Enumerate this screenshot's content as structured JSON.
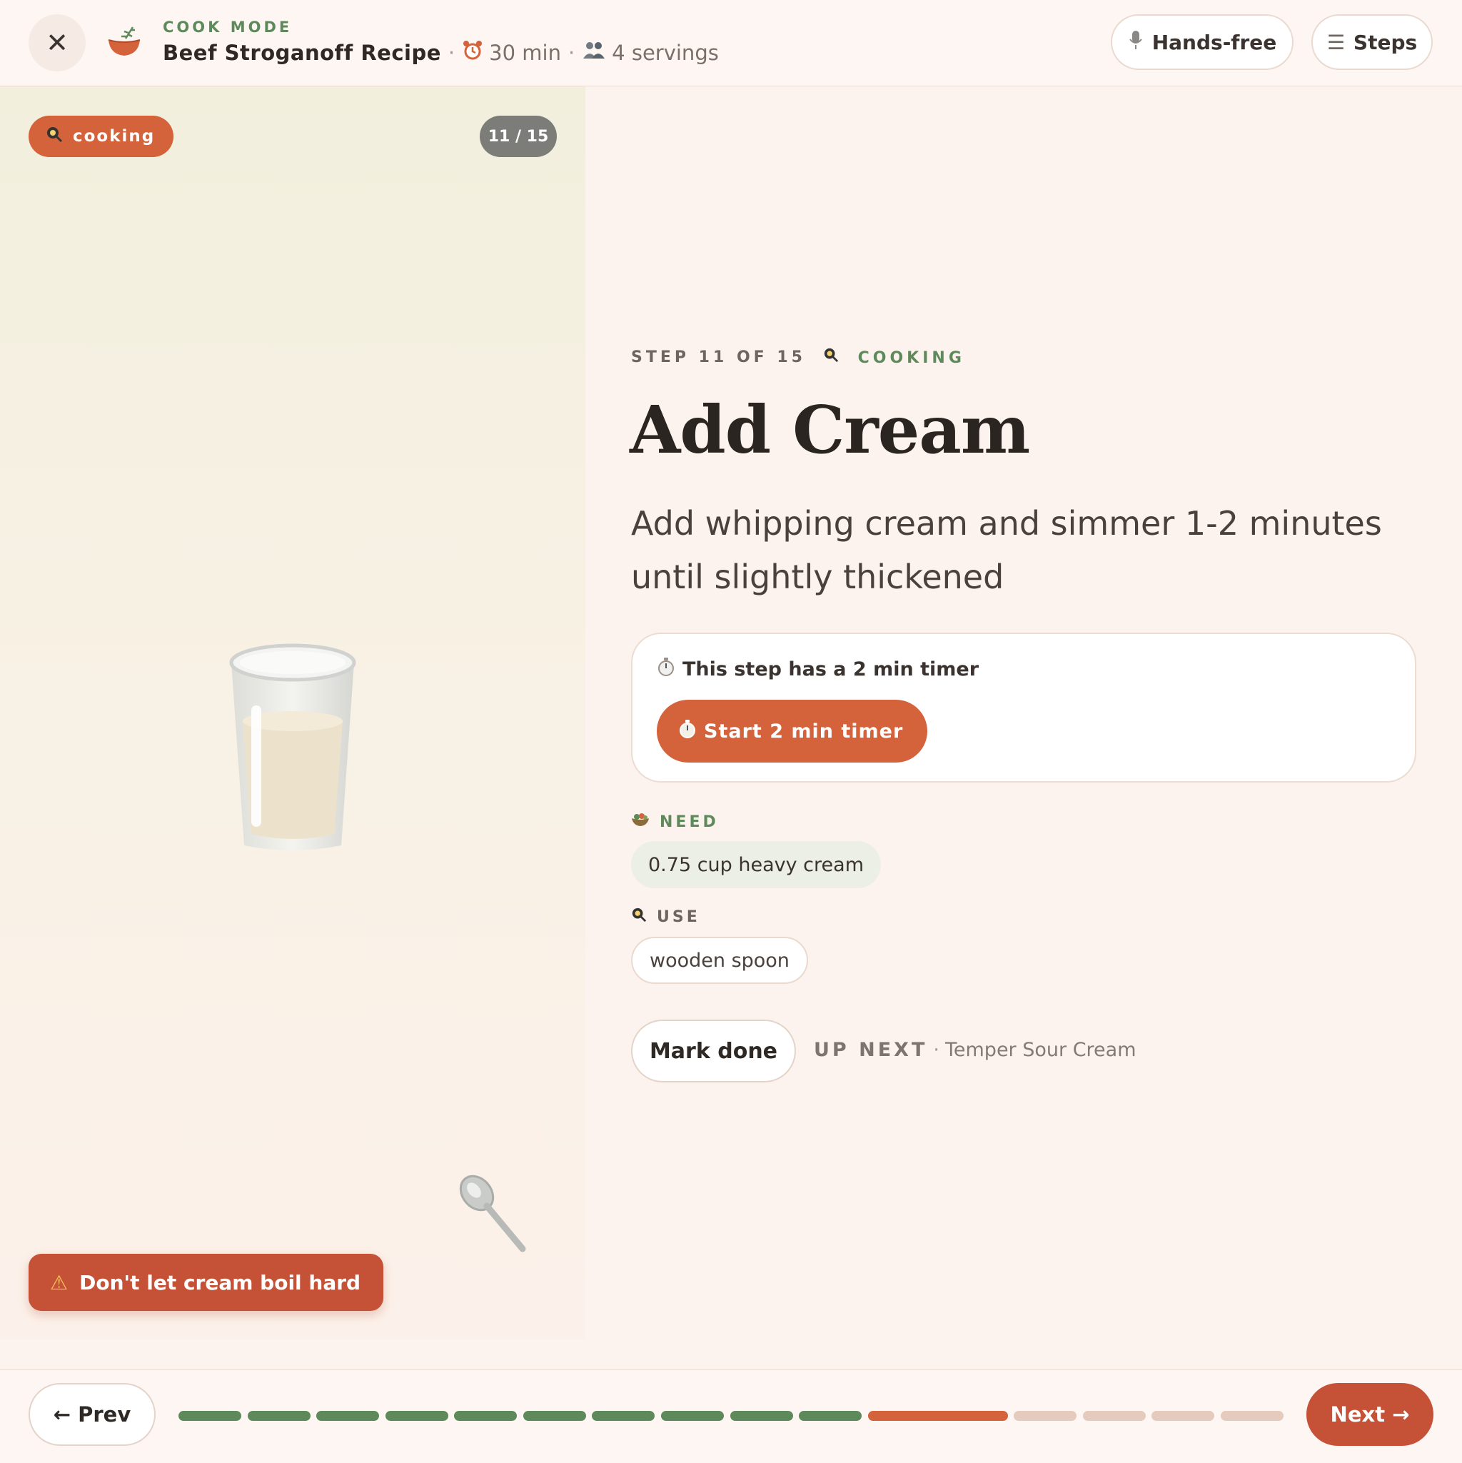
{
  "header": {
    "mode_label": "COOK MODE",
    "recipe_title": "Beef Stroganoff Recipe",
    "separator": "·",
    "time": "30 min",
    "time_icon": "alarm-clock-icon",
    "servings": "4 servings",
    "servings_icon": "people-icon",
    "close_icon": "close-icon",
    "close_glyph": "✕",
    "hands_free_label": "Hands-free",
    "hands_free_icon": "microphone-icon",
    "steps_label": "Steps",
    "steps_icon": "menu-icon",
    "steps_glyph": "☰"
  },
  "visual": {
    "category_badge": "cooking",
    "category_icon": "frying-pan-icon",
    "counter": "11 / 15",
    "illustration": "glass-of-cream-icon",
    "tool_illustration": "spoon-icon",
    "warning_text": "Don't let cream boil hard",
    "warning_icon": "warning-icon",
    "warning_glyph": "⚠"
  },
  "step": {
    "label": "STEP 11 OF 15",
    "category": "COOKING",
    "title": "Add Cream",
    "description": "Add whipping cream and simmer 1-2 minutes until slightly thickened",
    "timer_note": "This step has a 2 min timer",
    "timer_button": "Start 2 min timer",
    "timer_icon": "stopwatch-icon",
    "need_label": "NEED",
    "need_icon": "salad-bowl-icon",
    "ingredients": [
      "0.75 cup heavy cream"
    ],
    "use_label": "USE",
    "use_icon": "frying-pan-icon",
    "tools": [
      "wooden spoon"
    ],
    "mark_done": "Mark done",
    "up_next_label": "UP NEXT",
    "up_next_name": "Temper Sour Cream"
  },
  "footer": {
    "prev_label": "← Prev",
    "next_label": "Next →",
    "progress": {
      "total": 15,
      "current": 11,
      "completed": 10
    }
  },
  "colors": {
    "accent": "#d4623b",
    "accent_dark": "#c55236",
    "done_green": "#5e8a5b",
    "todo": "#e4cbbd",
    "background": "#fcf3ee"
  }
}
